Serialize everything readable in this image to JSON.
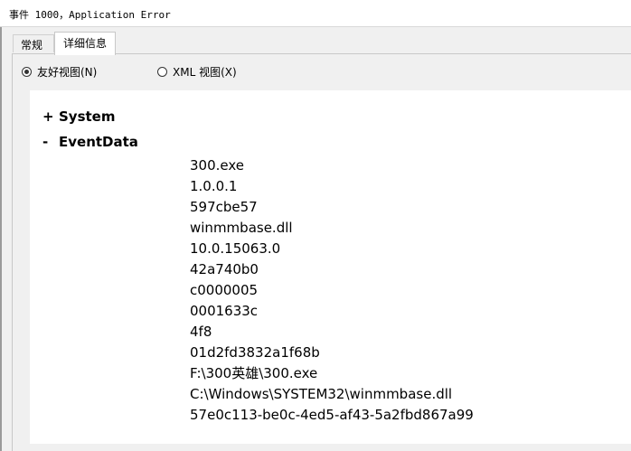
{
  "window": {
    "title": "事件 1000，Application Error"
  },
  "tabs": [
    {
      "label": "常规",
      "active": false
    },
    {
      "label": "详细信息",
      "active": true
    }
  ],
  "view_options": {
    "friendly": {
      "label": "友好视图(N)",
      "checked": true
    },
    "xml": {
      "label": "XML 视图(X)",
      "checked": false
    }
  },
  "tree": {
    "system": {
      "toggle": "+",
      "label": "System"
    },
    "eventdata": {
      "toggle": "-",
      "label": "EventData",
      "values": [
        "300.exe",
        "1.0.0.1",
        "597cbe57",
        "winmmbase.dll",
        "10.0.15063.0",
        "42a740b0",
        "c0000005",
        "0001633c",
        "4f8",
        "01d2fd3832a1f68b",
        "F:\\300英雄\\300.exe",
        "C:\\Windows\\SYSTEM32\\winmmbase.dll",
        "57e0c113-be0c-4ed5-af43-5a2fbd867a99"
      ]
    }
  }
}
